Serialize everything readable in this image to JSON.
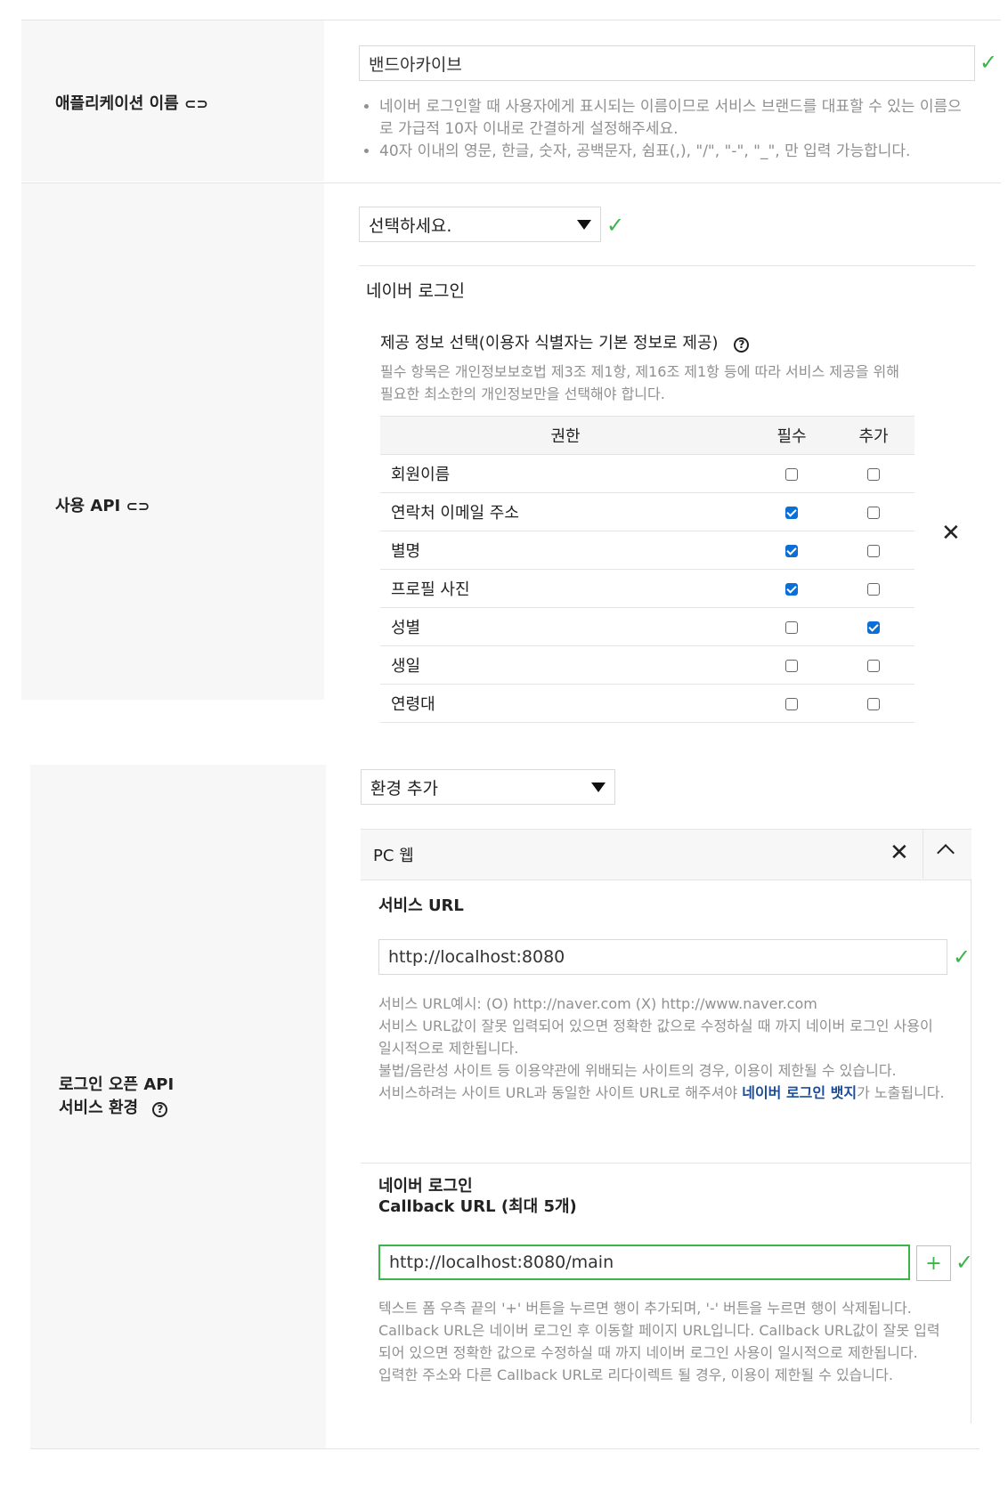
{
  "app_name_section": {
    "label": "애플리케이션 이름",
    "link_icon": "link-icon",
    "value": "밴드아카이브",
    "hints": [
      "네이버 로그인할 때 사용자에게 표시되는 이름이므로 서비스 브랜드를 대표할 수 있는 이름으로 가급적 10자 이내로 간결하게 설정해주세요.",
      "40자 이내의 영문, 한글, 숫자, 공백문자, 쉼표(,), \"/\", \"-\", \"_\", 만 입력 가능합니다."
    ]
  },
  "api_section": {
    "label": "사용 API",
    "select_value": "선택하세요.",
    "subheader": "네이버 로그인",
    "info_title": "제공 정보 선택(이용자 식별자는 기본 정보로 제공)",
    "info_desc": "필수 항목은 개인정보보호법 제3조 제1항, 제16조 제1항 등에 따라 서비스 제공을 위해 필요한 최소한의 개인정보만을 선택해야 합니다.",
    "table": {
      "headers": [
        "권한",
        "필수",
        "추가"
      ],
      "rows": [
        {
          "name": "회원이름",
          "required": false,
          "extra": false
        },
        {
          "name": "연락처 이메일 주소",
          "required": true,
          "extra": false
        },
        {
          "name": "별명",
          "required": true,
          "extra": false
        },
        {
          "name": "프로필 사진",
          "required": true,
          "extra": false
        },
        {
          "name": "성별",
          "required": false,
          "extra": true
        },
        {
          "name": "생일",
          "required": false,
          "extra": false
        },
        {
          "name": "연령대",
          "required": false,
          "extra": false
        }
      ]
    }
  },
  "env_section": {
    "label_line1": "로그인 오픈 API",
    "label_line2": "서비스 환경",
    "select_value": "환경 추가",
    "panel_title": "PC 웹",
    "service_url_label": "서비스 URL",
    "service_url_value": "http://localhost:8080",
    "service_url_notes": [
      "서비스 URL예시: (O) http://naver.com (X) http://www.naver.com",
      "서비스 URL값이 잘못 입력되어 있으면 정확한 값으로 수정하실 때 까지 네이버 로그인 사용이 일시적으로 제한됩니다.",
      "불법/음란성 사이트 등 이용약관에 위배되는 사이트의 경우, 이용이 제한될 수 있습니다."
    ],
    "badge_note_before": "서비스하려는 사이트 URL과 동일한 사이트 URL로 해주셔야 ",
    "badge_note_link": "네이버 로그인 뱃지",
    "badge_note_after": "가 노출됩니다.",
    "callback_label_line1": "네이버 로그인",
    "callback_label_line2": "Callback URL (최대 5개)",
    "callback_value": "http://localhost:8080/main",
    "plus_label": "+",
    "callback_notes": [
      "텍스트 폼 우측 끝의 '+' 버튼을 누르면 행이 추가되며, '-' 버튼을 누르면 행이 삭제됩니다.",
      "Callback URL은 네이버 로그인 후 이동할 페이지 URL입니다. Callback URL값이 잘못 입력되어 있으면 정확한 값으로 수정하실 때 까지 네이버 로그인 사용이 일시적으로 제한됩니다.",
      "입력한 주소와 다른 Callback URL로 리다이렉트 될 경우, 이용이 제한될 수 있습니다."
    ]
  },
  "icons": {
    "check": "✓",
    "close": "✕",
    "chevron_up": "︿",
    "help": "?",
    "link": "⊂⊃"
  },
  "colors": {
    "check_green": "#3ab54a",
    "checkbox_blue": "#0b6fd6",
    "link_blue": "#1a4c9c",
    "label_bg": "#f7f7f7"
  }
}
